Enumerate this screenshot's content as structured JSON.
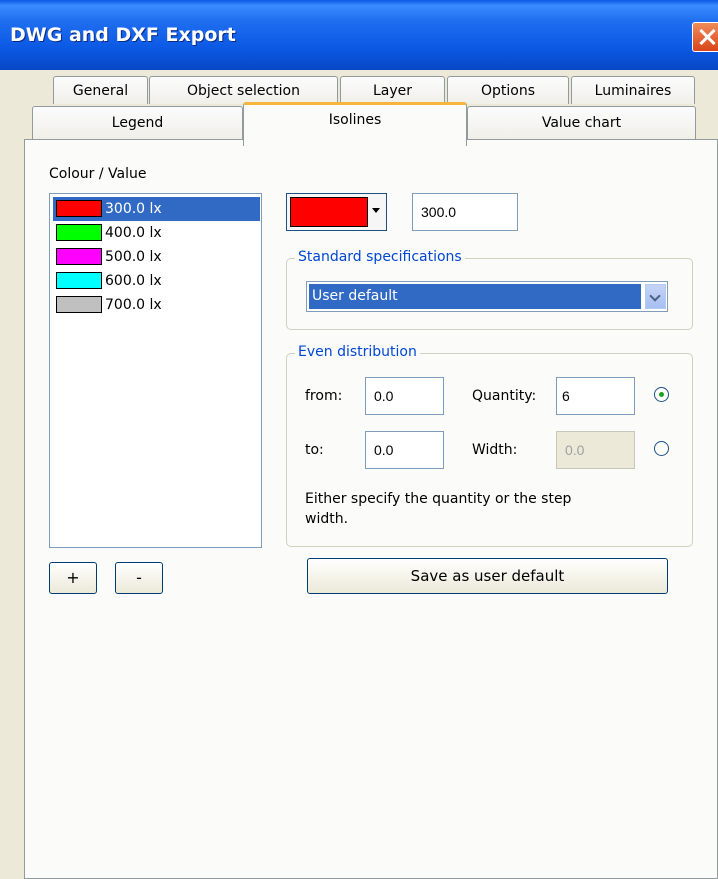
{
  "window": {
    "title": "DWG and DXF Export"
  },
  "tabs_row1": [
    "General",
    "Object selection",
    "Layer",
    "Options",
    "Luminaires"
  ],
  "tabs_row2": [
    "Legend",
    "Isolines",
    "Value chart"
  ],
  "active_tab": "Isolines",
  "colour_list": {
    "label": "Colour / Value",
    "items": [
      {
        "value": "300.0 lx",
        "color": "#ff0000",
        "selected": true
      },
      {
        "value": "400.0 lx",
        "color": "#00ff00",
        "selected": false
      },
      {
        "value": "500.0 lx",
        "color": "#ff00ff",
        "selected": false
      },
      {
        "value": "600.0 lx",
        "color": "#00ffff",
        "selected": false
      },
      {
        "value": "700.0 lx",
        "color": "#c0c0c0",
        "selected": false
      }
    ],
    "add_label": "+",
    "remove_label": "-"
  },
  "editor": {
    "selected_color": "#ff0000",
    "value": "300.0"
  },
  "standard_specs": {
    "legend": "Standard specifications",
    "selected": "User default"
  },
  "even_distribution": {
    "legend": "Even distribution",
    "from_label": "from:",
    "from_value": "0.0",
    "to_label": "to:",
    "to_value": "0.0",
    "quantity_label": "Quantity:",
    "quantity_value": "6",
    "width_label": "Width:",
    "width_value": "0.0",
    "quantity_selected": true,
    "note_line1": "Either specify the quantity or the step",
    "note_line2": "width."
  },
  "save_button": "Save as user default"
}
